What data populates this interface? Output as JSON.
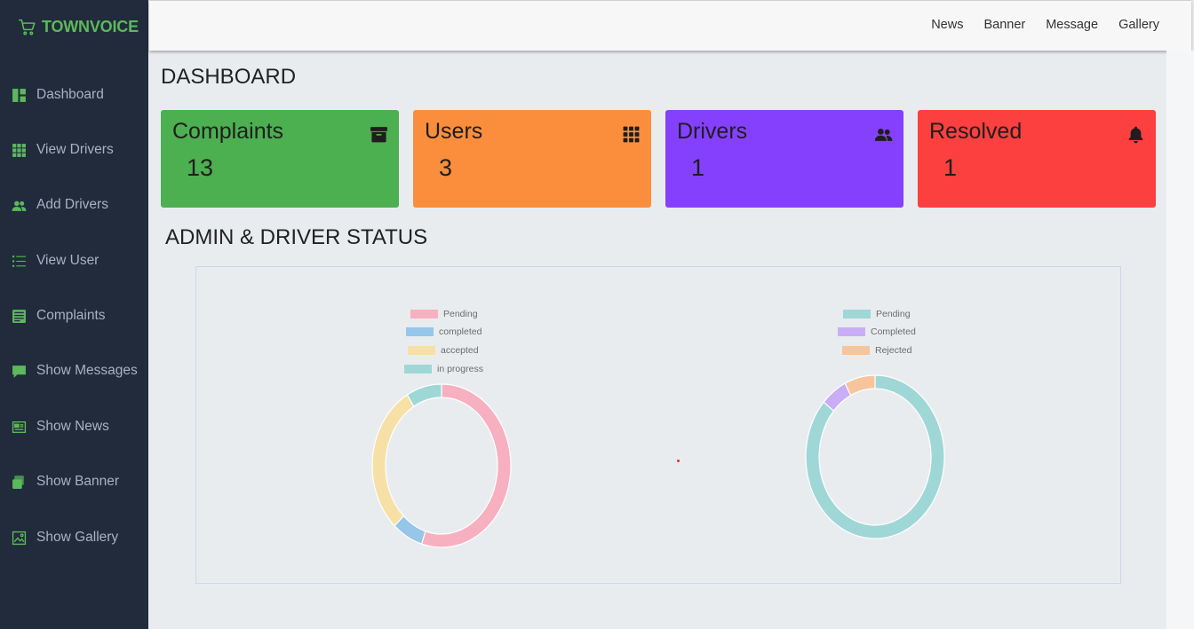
{
  "brand": {
    "name": "TOWNVOICE",
    "accent": "#5cb85c"
  },
  "sidebar": {
    "items": [
      {
        "label": "Dashboard",
        "icon": "dashboard-icon"
      },
      {
        "label": "View Drivers",
        "icon": "grid-icon"
      },
      {
        "label": "Add Drivers",
        "icon": "users-icon"
      },
      {
        "label": "View User",
        "icon": "list-icon"
      },
      {
        "label": "Complaints",
        "icon": "document-icon"
      },
      {
        "label": "Show Messages",
        "icon": "message-icon"
      },
      {
        "label": "Show News",
        "icon": "news-icon"
      },
      {
        "label": "Show Banner",
        "icon": "banner-icon"
      },
      {
        "label": "Show Gallery",
        "icon": "gallery-icon"
      }
    ]
  },
  "topnav": {
    "links": [
      "News",
      "Banner",
      "Message",
      "Gallery"
    ]
  },
  "page": {
    "title": "DASHBOARD",
    "section_title": "ADMIN & DRIVER STATUS"
  },
  "cards": [
    {
      "title": "Complaints",
      "value": "13",
      "color": "#4caf50",
      "icon": "archive-icon"
    },
    {
      "title": "Users",
      "value": "3",
      "color": "#fb8e3c",
      "icon": "grid-icon"
    },
    {
      "title": "Drivers",
      "value": "1",
      "color": "#8540fd",
      "icon": "users-icon"
    },
    {
      "title": "Resolved",
      "value": "1",
      "color": "#fc3f3f",
      "icon": "bell-icon"
    }
  ],
  "chart_data": [
    {
      "type": "pie",
      "categories": [
        "Pending",
        "completed",
        "accepted",
        "in progress"
      ],
      "values": [
        53,
        7,
        29,
        8
      ],
      "colors": [
        "#f7b0c0",
        "#96c6ea",
        "#f6e0a6",
        "#9ed7d6"
      ],
      "legend": "top"
    },
    {
      "type": "pie",
      "categories": [
        "Pending",
        "Completed",
        "Rejected"
      ],
      "values": [
        85,
        6,
        7
      ],
      "colors": [
        "#9ed7d6",
        "#c9aef7",
        "#f6c59c"
      ],
      "legend": "top"
    }
  ]
}
